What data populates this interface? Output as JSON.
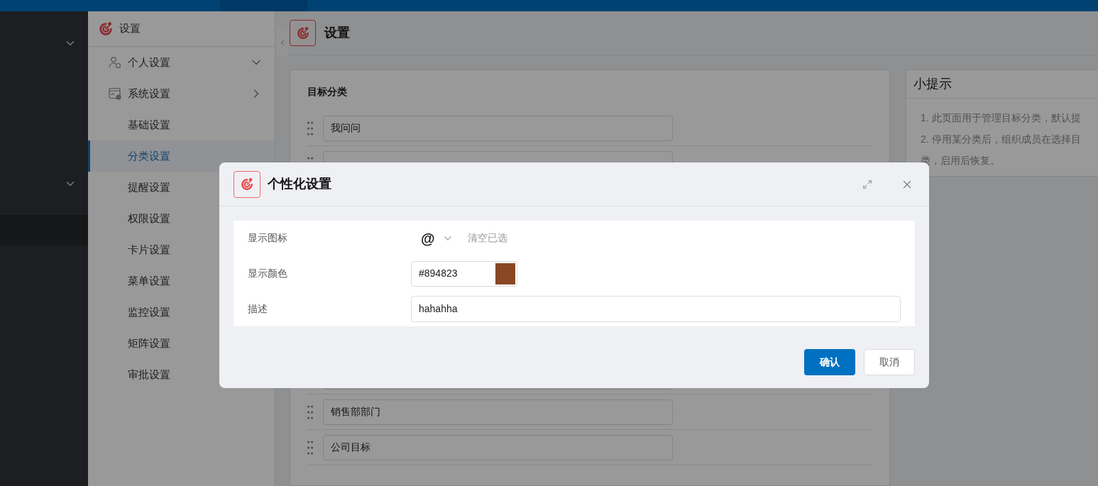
{
  "menu": {
    "title": "设置",
    "items": [
      {
        "label": "个人设置",
        "kind": "group",
        "expanded": false,
        "selected": false
      },
      {
        "label": "系统设置",
        "kind": "group",
        "expanded": true,
        "selected": false
      },
      {
        "label": "基础设置",
        "kind": "link",
        "selected": false
      },
      {
        "label": "分类设置",
        "kind": "link",
        "selected": true
      },
      {
        "label": "提醒设置",
        "kind": "link",
        "selected": false
      },
      {
        "label": "权限设置",
        "kind": "link",
        "selected": false
      },
      {
        "label": "卡片设置",
        "kind": "link",
        "selected": false
      },
      {
        "label": "菜单设置",
        "kind": "link",
        "selected": false
      },
      {
        "label": "监控设置",
        "kind": "link",
        "selected": false
      },
      {
        "label": "矩阵设置",
        "kind": "link",
        "selected": false
      },
      {
        "label": "审批设置",
        "kind": "link",
        "selected": false
      }
    ]
  },
  "page": {
    "title": "设置"
  },
  "categories": {
    "title": "目标分类",
    "top": [
      "我问问"
    ],
    "bottom": [
      "销售部部门",
      "公司目标"
    ]
  },
  "tips": {
    "title": "小提示",
    "lines": [
      "1. 此页面用于管理目标分类，默认提",
      "2. 停用某分类后，组织成员在选择目",
      "类，启用后恢复。"
    ]
  },
  "dialog": {
    "title": "个性化设置",
    "fields": [
      {
        "label": "显示图标",
        "kind": "icon",
        "value": "@",
        "action": "清空已选"
      },
      {
        "label": "显示颜色",
        "kind": "color",
        "value": "#894823",
        "color": "#894823"
      },
      {
        "label": "描述",
        "kind": "text",
        "value": "hahahha"
      }
    ],
    "buttons": [
      {
        "label": "确认",
        "primary": true
      },
      {
        "label": "取消",
        "primary": false
      }
    ]
  }
}
